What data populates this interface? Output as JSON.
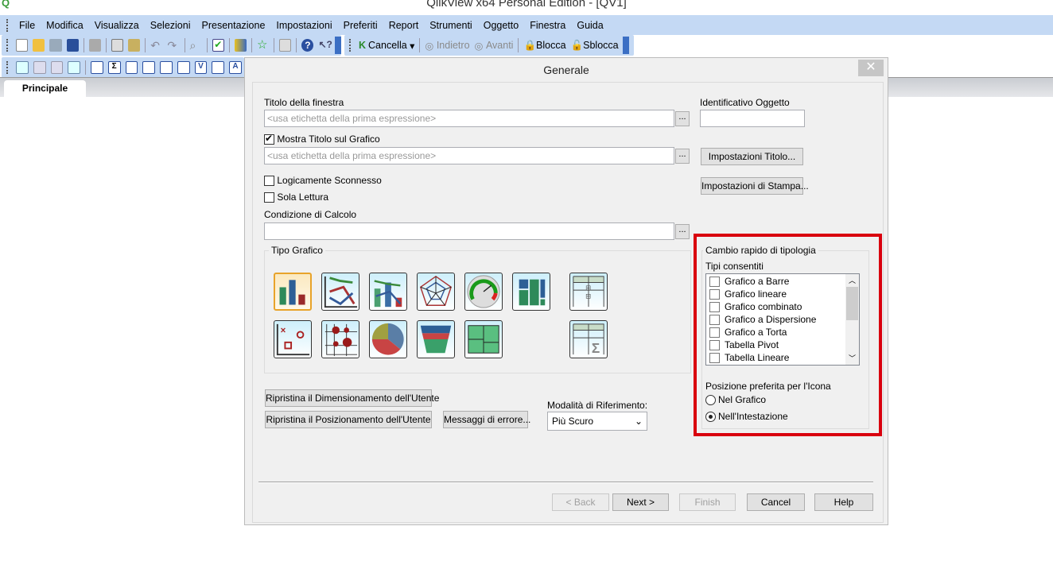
{
  "app": {
    "title": "QlikView x64 Personal Edition - [QV1]"
  },
  "menu": [
    "File",
    "Modifica",
    "Visualizza",
    "Selezioni",
    "Presentazione",
    "Impostazioni",
    "Preferiti",
    "Report",
    "Strumenti",
    "Oggetto",
    "Finestra",
    "Guida"
  ],
  "toolbar": {
    "cancella": "Cancella",
    "indietro": "Indietro",
    "avanti": "Avanti",
    "blocca": "Blocca",
    "sblocca": "Sblocca"
  },
  "sheet_tab": "Principale",
  "dialog": {
    "title": "Generale",
    "close": "✕",
    "window_title_label": "Titolo della finestra",
    "window_title_placeholder": "<usa etichetta della prima espressione>",
    "object_id_label": "Identificativo Oggetto",
    "object_id_value": "",
    "show_title_label": "Mostra Titolo sul Grafico",
    "show_title_checked": true,
    "chart_title_placeholder": "<usa etichetta della prima espressione>",
    "title_settings": "Impostazioni Titolo...",
    "print_settings": "Impostazioni di Stampa...",
    "detached_label": "Logicamente Sconnesso",
    "readonly_label": "Sola Lettura",
    "calc_condition_label": "Condizione di Calcolo",
    "calc_condition_value": "",
    "ellipsis": "...",
    "chart_type_label": "Tipo Grafico",
    "chart_types": [
      "Grafico a Barre",
      "Grafico lineare",
      "Grafico combinato",
      "Grafico Radar",
      "Indicatore",
      "Grafico a Blocchi",
      "Tabella Pivot",
      "Grafico a Dispersione",
      "Grafico a Griglia",
      "Grafico a Torta",
      "Grafico a Imbuto",
      "Mekko",
      "Tabella Lineare"
    ],
    "fast_change": {
      "title": "Cambio rapido di tipologia",
      "allowed_label": "Tipi consentiti",
      "items": [
        "Grafico a Barre",
        "Grafico lineare",
        "Grafico combinato",
        "Grafico a Dispersione",
        "Grafico a Torta",
        "Tabella Pivot",
        "Tabella Lineare"
      ],
      "icon_pos_label": "Posizione preferita per l'Icona",
      "radio_chart": "Nel Grafico",
      "radio_caption": "Nell'Intestazione",
      "selected": "Nell'Intestazione"
    },
    "reset_size": "Ripristina il Dimensionamento dell'Utente",
    "reset_pos": "Ripristina il Posizionamento dell'Utente",
    "error_msgs": "Messaggi di errore...",
    "ref_mode_label": "Modalità di Riferimento:",
    "ref_mode_value": "Più Scuro",
    "back": "< Back",
    "next": "Next >",
    "finish": "Finish",
    "cancel": "Cancel",
    "help": "Help"
  },
  "colors": {
    "highlight": "#d9000e",
    "menubar": "#c4d9f4"
  }
}
